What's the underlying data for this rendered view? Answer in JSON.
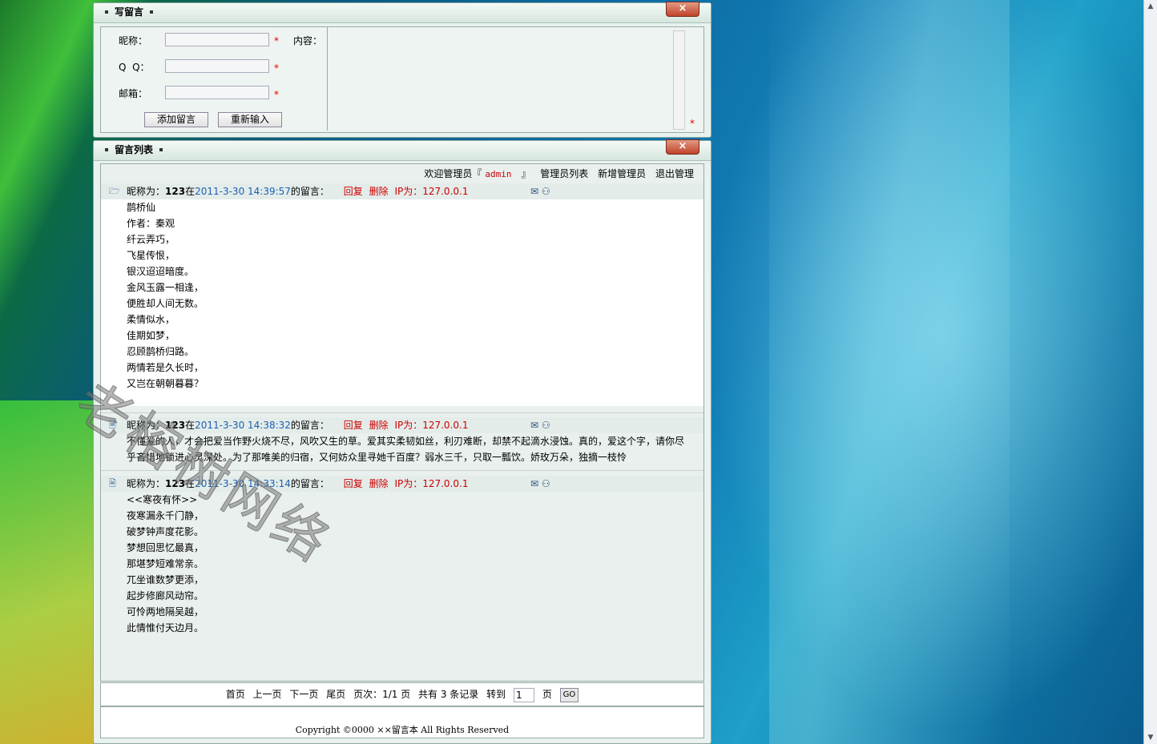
{
  "write_panel": {
    "title": "写留言",
    "close": "×",
    "nickname_label": "昵称：",
    "qq_label": "Q  Q：",
    "email_label": "邮箱：",
    "required_mark": "*",
    "content_label": "内容：",
    "add_button": "添加留言",
    "reset_button": "重新输入"
  },
  "list_panel": {
    "title": "留言列表",
    "close": "×",
    "admin_bar": {
      "welcome_prefix": "欢迎管理员『",
      "admin_name": "admin",
      "welcome_suffix": "』",
      "admin_list": "管理员列表",
      "add_admin": "新增管理员",
      "logout": "退出管理"
    },
    "messages": [
      {
        "prefix": "昵称为：",
        "nick": "123",
        "at": "在",
        "time": "2011-3-30 14:39:57",
        "suffix": "的留言：",
        "reply": "回复",
        "delete": "删除",
        "ip": "IP为：127.0.0.1",
        "lines": [
          "鹊桥仙",
          "作者：秦观",
          "纤云弄巧，",
          "飞星传恨，",
          "银汉迢迢暗度。",
          "金风玉露一相逢，",
          "便胜却人间无数。",
          "柔情似水，",
          "佳期如梦，",
          "忍顾鹊桥归路。",
          "两情若是久长时，",
          "又岂在朝朝暮暮？"
        ]
      },
      {
        "prefix": "昵称为：",
        "nick": "123",
        "at": "在",
        "time": "2011-3-30 14:38:32",
        "suffix": "的留言：",
        "reply": "回复",
        "delete": "删除",
        "ip": "IP为：127.0.0.1",
        "lines": [
          "不懂爱的人，才会把爱当作野火烧不尽，风吹又生的草。爱其实柔韧如丝，利刃难断，却禁不起滴水浸蚀。真的，爱这个字，请你尽",
          "乎吝惜地锁进心灵深处。为了那唯美的归宿，又何妨众里寻她千百度？弱水三千，只取一瓢饮。娇玫万朵，独摘一枝怜"
        ]
      },
      {
        "prefix": "昵称为：",
        "nick": "123",
        "at": "在",
        "time": "2011-3-30 14:33:14",
        "suffix": "的留言：",
        "reply": "回复",
        "delete": "删除",
        "ip": "IP为：127.0.0.1",
        "lines": [
          "<<寒夜有怀>>",
          "夜寒漏永千门静，",
          "破梦钟声度花影。",
          "梦想回思忆最真，",
          "那堪梦短难常亲。",
          "兀坐谁数梦更添，",
          "起步修廊风动帘。",
          "可怜两地隔吴越，",
          "此情惟付天边月。"
        ]
      }
    ],
    "pager": {
      "first": "首页",
      "prev": "上一页",
      "next": "下一页",
      "last": "尾页",
      "page_info": "页次：1/1 页",
      "total": "共有 3 条记录",
      "goto": "转到",
      "page_value": "1",
      "page_unit": "页",
      "go": "GO"
    },
    "footer": "Copyright ©0000 ××留言本 All Rights Reserved"
  },
  "watermark": "老榕树网络",
  "colors": {
    "accent_red": "#cc0000",
    "time_blue": "#1a5fb0",
    "close_red": "#c0432a"
  }
}
